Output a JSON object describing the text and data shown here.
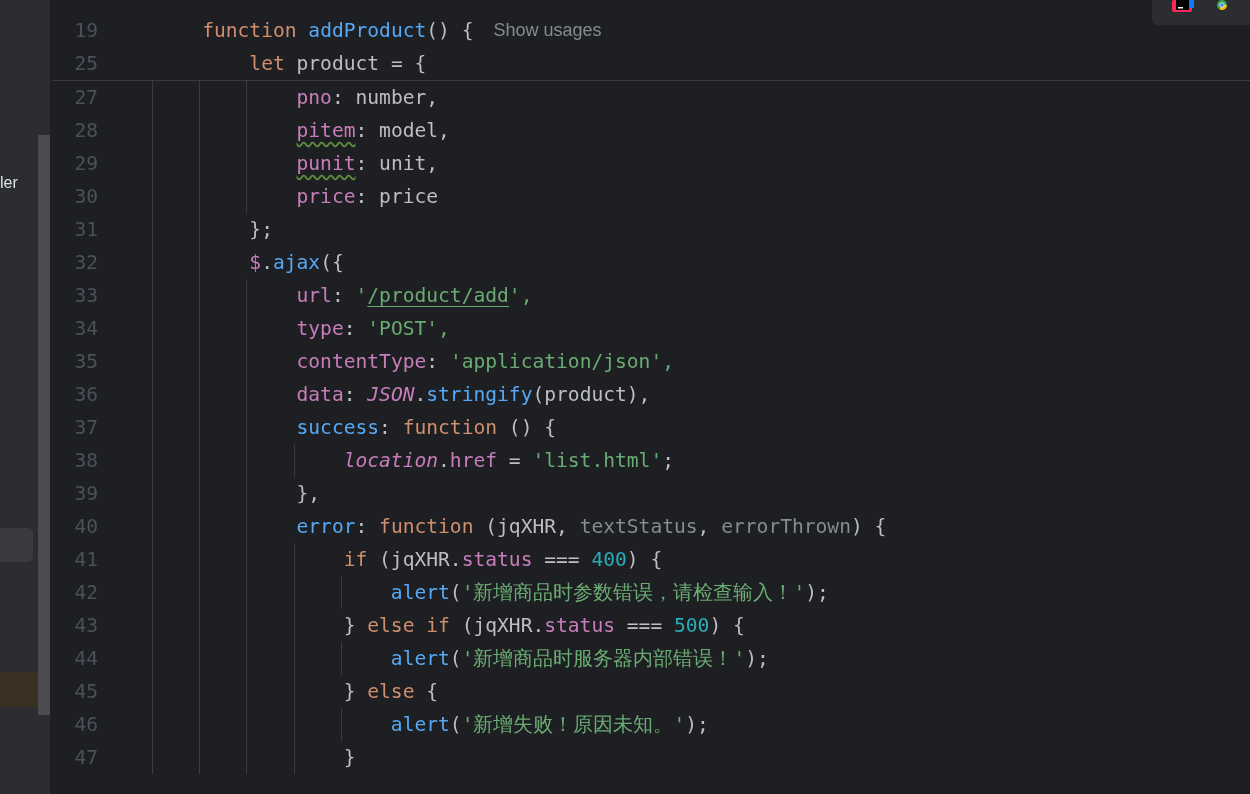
{
  "sidebar": {
    "text_fragment": "ler",
    "selected_row": {
      "selected": true
    },
    "current_row": {
      "highlighted": true
    }
  },
  "editor": {
    "lines": [
      {
        "number": "19",
        "sticky": true,
        "tokens": [
          {
            "text": "function",
            "kind": "kw"
          },
          {
            "text": " addProduct",
            "kind": "fn"
          },
          {
            "text": "() {",
            "kind": "plain"
          }
        ],
        "hint": "Show usages",
        "children": [
          {
            "number": "25",
            "sticky": true,
            "tokens": [
              {
                "text": "let",
                "kind": "kw"
              },
              {
                "text": " product = {",
                "kind": "plain"
              }
            ],
            "children": [
              {
                "number": "27",
                "sticky": false,
                "tokens": [
                  {
                    "text": "pno",
                    "kind": "prop"
                  },
                  {
                    "text": ": number,",
                    "kind": "plain"
                  }
                ]
              },
              {
                "number": "28",
                "sticky": false,
                "tokens": [
                  {
                    "text": "pitem",
                    "kind": "prop",
                    "typo": true
                  },
                  {
                    "text": ": model,",
                    "kind": "plain"
                  }
                ]
              },
              {
                "number": "29",
                "sticky": false,
                "tokens": [
                  {
                    "text": "punit",
                    "kind": "prop",
                    "typo": true
                  },
                  {
                    "text": ": unit,",
                    "kind": "plain"
                  }
                ]
              },
              {
                "number": "30",
                "sticky": false,
                "tokens": [
                  {
                    "text": "price",
                    "kind": "prop"
                  },
                  {
                    "text": ": price",
                    "kind": "plain"
                  }
                ]
              }
            ]
          },
          {
            "number": "31",
            "sticky": false,
            "tokens": [
              {
                "text": "};",
                "kind": "plain"
              }
            ]
          },
          {
            "number": "32",
            "sticky": false,
            "tokens": [
              {
                "text": "$",
                "kind": "prop"
              },
              {
                "text": ".ajax",
                "kind": "fn"
              },
              {
                "text": "({",
                "kind": "plain"
              }
            ],
            "children": [
              {
                "number": "33",
                "sticky": false,
                "tokens": [
                  {
                    "text": "url",
                    "kind": "prop"
                  },
                  {
                    "text": ": '",
                    "kind": "str"
                  },
                  {
                    "text": "/product/add",
                    "kind": "str",
                    "link": true
                  },
                  {
                    "text": "',",
                    "kind": "str"
                  }
                ]
              },
              {
                "number": "34",
                "sticky": false,
                "tokens": [
                  {
                    "text": "type",
                    "kind": "prop"
                  },
                  {
                    "text": ": 'POST',",
                    "kind": "str"
                  }
                ]
              },
              {
                "number": "35",
                "sticky": false,
                "tokens": [
                  {
                    "text": "contentType",
                    "kind": "prop"
                  },
                  {
                    "text": ": 'application/json',",
                    "kind": "str"
                  }
                ]
              },
              {
                "number": "36",
                "sticky": false,
                "tokens": [
                  {
                    "text": "data",
                    "kind": "prop"
                  },
                  {
                    "text": ": JSON",
                    "kind": "global"
                  },
                  {
                    "text": ".stringify",
                    "kind": "fn"
                  },
                  {
                    "text": "(product),",
                    "kind": "plain"
                  }
                ]
              },
              {
                "number": "37",
                "sticky": false,
                "tokens": [
                  {
                    "text": "success",
                    "kind": "fn"
                  },
                  {
                    "text": ": function",
                    "kind": "kw"
                  },
                  {
                    "text": " () {",
                    "kind": "plain"
                  }
                ],
                "children": [
                  {
                    "number": "38",
                    "sticky": false,
                    "tokens": [
                      {
                        "text": "location",
                        "kind": "global"
                      },
                      {
                        "text": ".href",
                        "kind": "prop"
                      },
                      {
                        "text": " = ",
                        "kind": "plain"
                      },
                      {
                        "text": "'list.html'",
                        "kind": "str"
                      },
                      {
                        "text": ";",
                        "kind": "plain"
                      }
                    ]
                  }
                ]
              },
              {
                "number": "39",
                "sticky": false,
                "tokens": [
                  {
                    "text": "},",
                    "kind": "plain"
                  }
                ]
              },
              {
                "number": "40",
                "sticky": false,
                "tokens": [
                  {
                    "text": "error",
                    "kind": "fn"
                  },
                  {
                    "text": ": function",
                    "kind": "kw"
                  },
                  {
                    "text": " (jqXHR, ",
                    "kind": "plain"
                  },
                  {
                    "text": "textStatus",
                    "kind": "param"
                  },
                  {
                    "text": ", ",
                    "kind": "plain"
                  },
                  {
                    "text": "errorThrown",
                    "kind": "param"
                  },
                  {
                    "text": ") {",
                    "kind": "plain"
                  }
                ],
                "children": [
                  {
                    "number": "41",
                    "sticky": false,
                    "tokens": [
                      {
                        "text": "if",
                        "kind": "kw"
                      },
                      {
                        "text": " (jqXHR.",
                        "kind": "plain"
                      },
                      {
                        "text": "status",
                        "kind": "prop"
                      },
                      {
                        "text": " === ",
                        "kind": "plain"
                      },
                      {
                        "text": "400",
                        "kind": "num"
                      },
                      {
                        "text": ") {",
                        "kind": "plain"
                      }
                    ],
                    "children": [
                      {
                        "number": "42",
                        "sticky": false,
                        "tokens": [
                          {
                            "text": "alert",
                            "kind": "fn"
                          },
                          {
                            "text": "(",
                            "kind": "plain"
                          },
                          {
                            "text": "'新增商品时参数错误，请检查输入！'",
                            "kind": "str"
                          },
                          {
                            "text": ");",
                            "kind": "plain"
                          }
                        ]
                      }
                    ]
                  },
                  {
                    "number": "43",
                    "sticky": false,
                    "tokens": [
                      {
                        "text": "} ",
                        "kind": "plain"
                      },
                      {
                        "text": "else if",
                        "kind": "kw"
                      },
                      {
                        "text": " (jqXHR.",
                        "kind": "plain"
                      },
                      {
                        "text": "status",
                        "kind": "prop"
                      },
                      {
                        "text": " === ",
                        "kind": "plain"
                      },
                      {
                        "text": "500",
                        "kind": "num"
                      },
                      {
                        "text": ") {",
                        "kind": "plain"
                      }
                    ],
                    "children": [
                      {
                        "number": "44",
                        "sticky": false,
                        "tokens": [
                          {
                            "text": "alert",
                            "kind": "fn"
                          },
                          {
                            "text": "(",
                            "kind": "plain"
                          },
                          {
                            "text": "'新增商品时服务器内部错误！'",
                            "kind": "str"
                          },
                          {
                            "text": ");",
                            "kind": "plain"
                          }
                        ]
                      }
                    ]
                  },
                  {
                    "number": "45",
                    "sticky": false,
                    "tokens": [
                      {
                        "text": "} ",
                        "kind": "plain"
                      },
                      {
                        "text": "else",
                        "kind": "kw"
                      },
                      {
                        "text": " {",
                        "kind": "plain"
                      }
                    ],
                    "children": [
                      {
                        "number": "46",
                        "sticky": false,
                        "tokens": [
                          {
                            "text": "alert",
                            "kind": "fn"
                          },
                          {
                            "text": "(",
                            "kind": "plain"
                          },
                          {
                            "text": "'新增失败！原因未知。'",
                            "kind": "str"
                          },
                          {
                            "text": ");",
                            "kind": "plain"
                          }
                        ]
                      }
                    ]
                  },
                  {
                    "number": "47",
                    "sticky": false,
                    "tokens": [
                      {
                        "text": "}",
                        "kind": "plain"
                      }
                    ]
                  }
                ]
              }
            ]
          }
        ]
      }
    ]
  }
}
